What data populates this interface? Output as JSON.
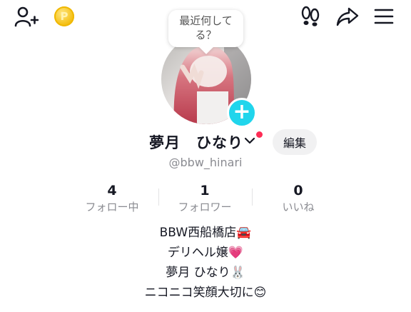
{
  "bubble": {
    "line1": "最近何して",
    "line2": "る？"
  },
  "profile": {
    "display_name": "夢月　ひなり",
    "username": "@bbw_hinari",
    "edit_label": "編集",
    "coin_letter": "P"
  },
  "stats": [
    {
      "value": "4",
      "label": "フォロー中"
    },
    {
      "value": "1",
      "label": "フォロワー"
    },
    {
      "value": "0",
      "label": "いいね"
    }
  ],
  "bio": [
    "BBW西船橋店🚘",
    "デリヘル嬢💗",
    "夢月 ひなり🐰",
    "ニコニコ笑顔大切に😊"
  ],
  "icons": {
    "top_left": [
      "add-user-icon",
      "coin-icon"
    ],
    "top_right": [
      "footprint-icon",
      "share-icon",
      "menu-icon"
    ]
  },
  "colors": {
    "accent": "#20d5ec",
    "notification": "#fe2c55",
    "coin": "#f5c21b"
  }
}
